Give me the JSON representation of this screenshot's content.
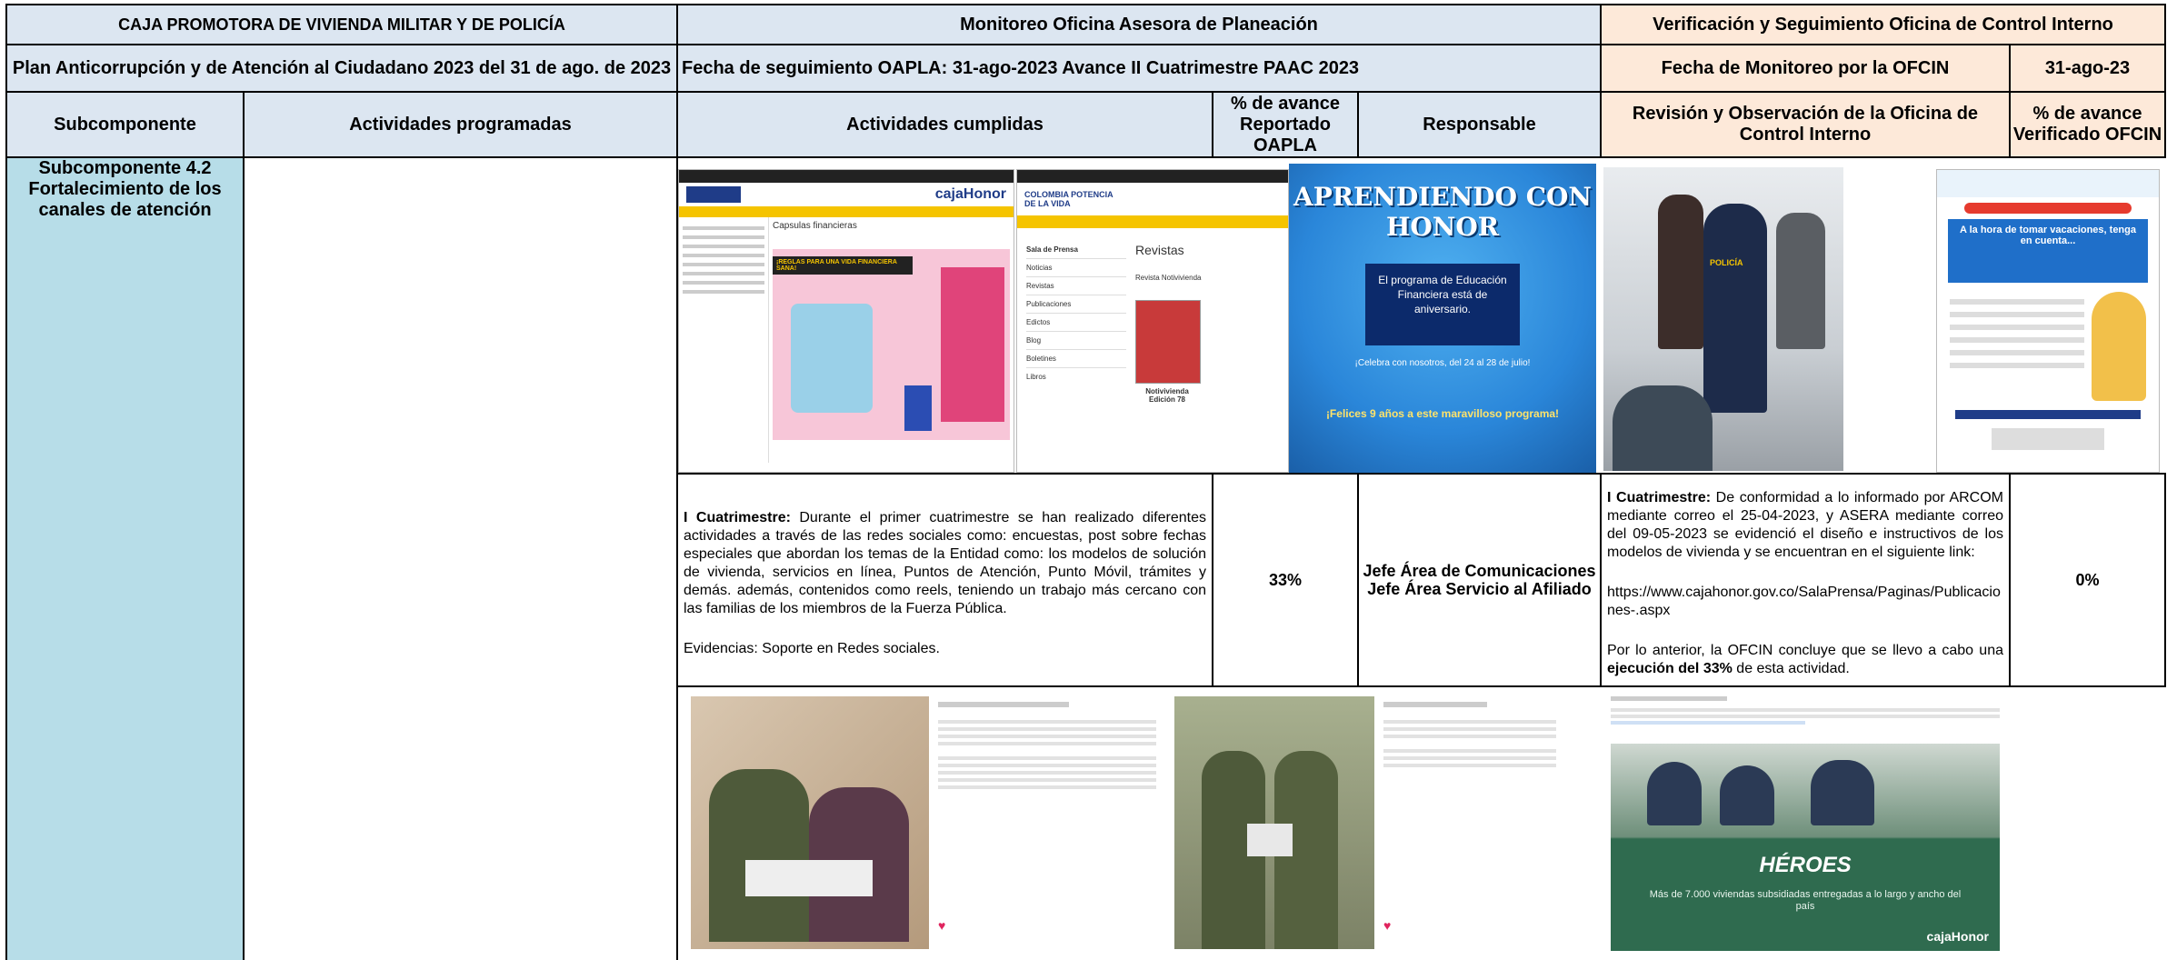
{
  "header": {
    "org_title": "CAJA PROMOTORA DE VIVIENDA MILITAR Y DE POLICÍA",
    "plan_title": "Plan Anticorrupción y de Atención al Ciudadano  2023  del 31 de ago. de 2023",
    "monitoring_title": "Monitoreo Oficina Asesora de Planeación",
    "followup_date": "Fecha de seguimiento OAPLA:   31-ago-2023 Avance II Cuatrimestre PAAC 2023",
    "verification_title": "Verificación y Seguimiento Oficina de Control Interno",
    "ofcin_date_label": "Fecha de Monitoreo por la OFCIN",
    "ofcin_date_value": "31-ago-23"
  },
  "columns": {
    "subcomponent": "Subcomponente",
    "programmed": "Actividades programadas",
    "completed": "Actividades cumplidas",
    "progress_oapla": "% de avance Reportado OAPLA",
    "responsible": "Responsable",
    "ofcin_review": "Revisión y Observación de la Oficina de Control Interno",
    "progress_ofcin": "% de avance Verificado OFCIN"
  },
  "row": {
    "subcomponent": "Subcomponente 4.2 Fortalecimiento de los canales de atención",
    "completed_label": "I Cuatrimestre:",
    "completed_text": " Durante el primer cuatrimestre se han realizado diferentes actividades a través de las redes sociales como: encuestas, post sobre fechas especiales que abordan los temas de la Entidad como: los modelos de solución de vivienda, servicios en línea, Puntos de Atención, Punto Móvil, trámites y demás. además, contenidos como reels, teniendo un trabajo más cercano con las familias de los miembros de la Fuerza Pública.",
    "evidence": "Evidencias: Soporte en Redes sociales.",
    "progress_oapla": "33%",
    "responsible_1": "Jefe Área de Comunicaciones",
    "responsible_2": "Jefe Área Servicio al Afiliado",
    "review_label": "I Cuatrimestre:",
    "review_text": "  De conformidad a lo informado por  ARCOM mediante correo el  25-04-2023,  y ASERA mediante correo del 09-05-2023 se evidenció el diseño e instructivos  de los modelos de vivienda y se encuentran en el siguiente link:",
    "review_link": "https://www.cajahonor.gov.co/SalaPrensa/Paginas/Publicaciones-.aspx",
    "review_conclusion_pre": "Por lo anterior,  la OFCIN concluye  que se llevo a cabo una ",
    "review_conclusion_bold": "ejecución del 33%",
    "review_conclusion_post": " de esta actividad.",
    "progress_ofcin": "0%"
  },
  "images": {
    "site1_logo": "cajaHonor",
    "site1_heading": "Capsulas financieras",
    "site1_banner": "¡REGLAS PARA UNA VIDA FINANCIERA SANA!",
    "site2_logo": "COLOMBIA POTENCIA DE LA VIDA",
    "site2_heading": "Revistas",
    "site2_sub": "Revista Notivivienda",
    "site2_menu": [
      "Sala de Prensa",
      "Noticias",
      "Revistas",
      "Publicaciones",
      "Edictos",
      "Blog",
      "Boletines",
      "Libros"
    ],
    "site2_caption": "Notivivienda Edición 78",
    "poster_title": "APRENDIENDO CON HONOR",
    "poster_box": "El programa de Educación Financiera está de aniversario.",
    "poster_line1": "¡Celebra con nosotros, del 24 al 28 de julio!",
    "poster_line2": "¡Felices 9 años a este maravilloso programa!",
    "police_label": "POLICÍA",
    "vac_heading": "A la hora de tomar vacaciones, tenga en cuenta...",
    "heroes_title": "HÉROES",
    "heroes_sub": "Más de 7.000 viviendas subsidiadas entregadas a lo largo y ancho del país",
    "heroes_brand": "cajaHonor",
    "colors": {
      "yellow": "#f5c400",
      "navy": "#1f3c88",
      "poster_blue": "#2a86d9",
      "army_green": "#4e5a3a",
      "heroes_green": "#2f6b4f"
    }
  }
}
